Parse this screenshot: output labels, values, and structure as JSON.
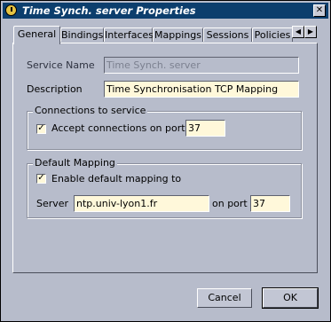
{
  "window": {
    "title": "Time Synch. server Properties",
    "close_glyph": "✕"
  },
  "tabs": [
    {
      "label": "General",
      "active": true
    },
    {
      "label": "Bindings"
    },
    {
      "label": "Interfaces"
    },
    {
      "label": "Mappings"
    },
    {
      "label": "Sessions"
    },
    {
      "label": "Policies"
    }
  ],
  "tab_scroll": {
    "left": "◀",
    "right": "▶"
  },
  "general": {
    "service_name_label": "Service Name",
    "service_name_value": "Time Synch. server",
    "description_label": "Description",
    "description_value": "Time Synchronisation TCP Mapping"
  },
  "connections": {
    "group_title": "Connections to service",
    "accept_checked": true,
    "accept_label": "Accept connections on port",
    "port_value": "37"
  },
  "mapping": {
    "group_title": "Default Mapping",
    "enable_checked": true,
    "enable_label": "Enable default mapping to",
    "server_label": "Server",
    "server_value": "ntp.univ-lyon1.fr",
    "on_port_label": "on port",
    "port_value": "37"
  },
  "buttons": {
    "cancel": "Cancel",
    "ok": "OK"
  },
  "check_glyph": "✓"
}
